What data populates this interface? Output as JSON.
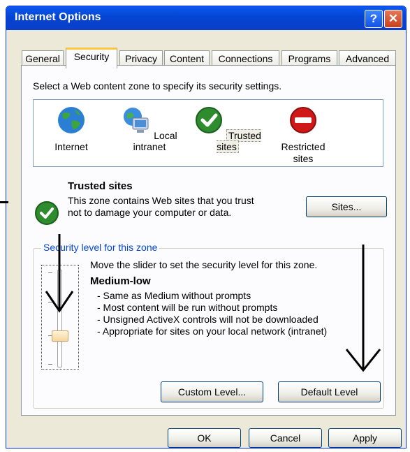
{
  "window": {
    "title": "Internet Options",
    "help_label": "?",
    "close_label": "✕"
  },
  "tabs": [
    {
      "label": "General",
      "active": false
    },
    {
      "label": "Security",
      "active": true
    },
    {
      "label": "Privacy",
      "active": false
    },
    {
      "label": "Content",
      "active": false
    },
    {
      "label": "Connections",
      "active": false
    },
    {
      "label": "Programs",
      "active": false
    },
    {
      "label": "Advanced",
      "active": false
    }
  ],
  "security": {
    "zone_prompt": "Select a Web content zone to specify its security settings.",
    "zones": [
      {
        "label": "Internet",
        "icon": "globe-icon"
      },
      {
        "label": "Local intranet",
        "icon": "monitor-globe-icon"
      },
      {
        "label": "Trusted sites",
        "icon": "checkmark-icon",
        "selected": true
      },
      {
        "label": "Restricted sites",
        "icon": "no-entry-icon"
      }
    ],
    "selected_zone": {
      "title": "Trusted sites",
      "description": "This zone contains Web sites that you trust not to damage your computer or data."
    },
    "sites_button": "Sites...",
    "level_group_label": "Security level for this zone",
    "slider_instruction": "Move the slider to set the security level for this zone.",
    "level_name": "Medium-low",
    "level_details": [
      "- Same as Medium without prompts",
      "- Most content will be run without prompts",
      "- Unsigned ActiveX controls will not be downloaded",
      "- Appropriate for sites on your local network (intranet)"
    ],
    "custom_level_button": "Custom Level...",
    "default_level_button": "Default Level"
  },
  "footer": {
    "ok": "OK",
    "cancel": "Cancel",
    "apply": "Apply"
  },
  "colors": {
    "titlebar": "#0a4fe0",
    "dialog_bg": "#ece9d8",
    "legend_blue": "#0046d5",
    "check_green": "#2e8b2e",
    "stop_red": "#d01818"
  }
}
